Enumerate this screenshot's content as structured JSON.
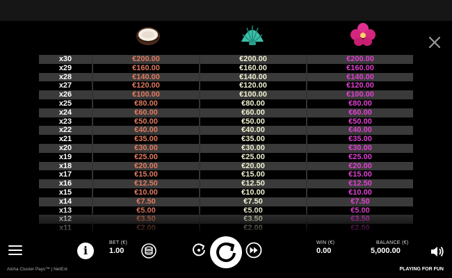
{
  "symbols": [
    {
      "name": "coconut-icon",
      "color": "#e07a5f"
    },
    {
      "name": "shell-icon",
      "color": "#f2f2d2"
    },
    {
      "name": "flower-icon",
      "color": "#e040d0"
    }
  ],
  "paytable": {
    "rows": [
      {
        "mult": "x30",
        "v1": "€200.00",
        "v2": "€200.00",
        "v3": "€200.00"
      },
      {
        "mult": "x29",
        "v1": "€160.00",
        "v2": "€160.00",
        "v3": "€160.00"
      },
      {
        "mult": "x28",
        "v1": "€140.00",
        "v2": "€140.00",
        "v3": "€140.00"
      },
      {
        "mult": "x27",
        "v1": "€120.00",
        "v2": "€120.00",
        "v3": "€120.00"
      },
      {
        "mult": "x26",
        "v1": "€100.00",
        "v2": "€100.00",
        "v3": "€100.00"
      },
      {
        "mult": "x25",
        "v1": "€80.00",
        "v2": "€80.00",
        "v3": "€80.00"
      },
      {
        "mult": "x24",
        "v1": "€60.00",
        "v2": "€60.00",
        "v3": "€60.00"
      },
      {
        "mult": "x23",
        "v1": "€50.00",
        "v2": "€50.00",
        "v3": "€50.00"
      },
      {
        "mult": "x22",
        "v1": "€40.00",
        "v2": "€40.00",
        "v3": "€40.00"
      },
      {
        "mult": "x21",
        "v1": "€35.00",
        "v2": "€35.00",
        "v3": "€35.00"
      },
      {
        "mult": "x20",
        "v1": "€30.00",
        "v2": "€30.00",
        "v3": "€30.00"
      },
      {
        "mult": "x19",
        "v1": "€25.00",
        "v2": "€25.00",
        "v3": "€25.00"
      },
      {
        "mult": "x18",
        "v1": "€20.00",
        "v2": "€20.00",
        "v3": "€20.00"
      },
      {
        "mult": "x17",
        "v1": "€15.00",
        "v2": "€15.00",
        "v3": "€15.00"
      },
      {
        "mult": "x16",
        "v1": "€12.50",
        "v2": "€12.50",
        "v3": "€12.50"
      },
      {
        "mult": "x15",
        "v1": "€10.00",
        "v2": "€10.00",
        "v3": "€10.00"
      },
      {
        "mult": "x14",
        "v1": "€7.50",
        "v2": "€7.50",
        "v3": "€7.50"
      },
      {
        "mult": "x13",
        "v1": "€5.00",
        "v2": "€5.00",
        "v3": "€5.00"
      },
      {
        "mult": "x12",
        "v1": "€3.50",
        "v2": "€3.50",
        "v3": "€3.50"
      },
      {
        "mult": "x11",
        "v1": "€2.00",
        "v2": "€2.00",
        "v3": "€2.00"
      }
    ]
  },
  "controls": {
    "bet_label": "BET (€)",
    "bet_value": "1.00",
    "win_label": "WIN (€)",
    "win_value": "0.00",
    "balance_label": "BALANCE (€)",
    "balance_value": "5,000.00"
  },
  "footer": {
    "game_title": "Aloha Cluster Pays™ | NetEnt",
    "mode": "PLAYING FOR FUN"
  },
  "icons": {
    "close": "close-icon",
    "menu": "hamburger-menu-icon",
    "info": "info-icon",
    "coins": "coin-stack-icon",
    "autoplay": "autoplay-icon",
    "spin": "spin-icon",
    "turbo": "fast-forward-icon",
    "sound": "speaker-icon"
  }
}
